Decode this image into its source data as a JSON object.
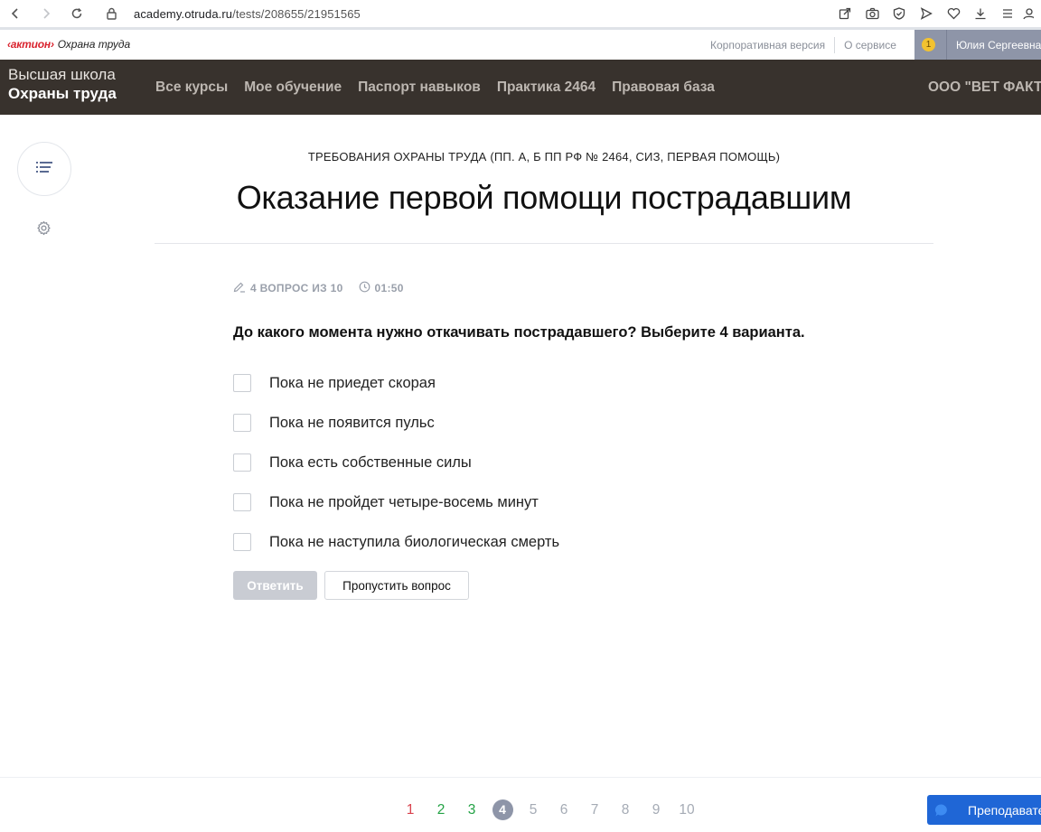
{
  "browser": {
    "url_host": "academy.otruda.ru",
    "url_path": "/tests/208655/21951565"
  },
  "site": {
    "brand": "актион",
    "brand_sub": "Охрана труда",
    "links": [
      "Корпоративная версия",
      "О сервисе"
    ],
    "user_badge": "1",
    "user_name": "Юлия Сергеевна"
  },
  "nav": {
    "school_line1": "Высшая школа",
    "school_line2": "Охраны труда",
    "items": [
      "Все курсы",
      "Мое обучение",
      "Паспорт навыков",
      "Практика 2464",
      "Правовая база"
    ],
    "org": "ООО \"ВЕТ ФАКТ"
  },
  "test": {
    "course": "ТРЕБОВАНИЯ ОХРАНЫ ТРУДА (ПП. А, Б ПП РФ № 2464, СИЗ, ПЕРВАЯ ПОМОЩЬ)",
    "title": "Оказание первой помощи пострадавшим",
    "progress": "4 ВОПРОС ИЗ 10",
    "timer": "01:50",
    "question": "До какого момента нужно откачивать пострадавшего? Выберите 4 варианта.",
    "options": [
      "Пока не приедет скорая",
      "Пока не появится пульс",
      "Пока есть собственные силы",
      "Пока не пройдет четыре-восемь минут",
      "Пока не наступила биологическая смерть"
    ],
    "answer_label": "Ответить",
    "skip_label": "Пропустить вопрос"
  },
  "pager": {
    "pages": [
      "1",
      "2",
      "3",
      "4",
      "5",
      "6",
      "7",
      "8",
      "9",
      "10"
    ],
    "current": "4",
    "colors": {
      "wrong": "#d9434e",
      "correct": "#23a245",
      "current_bg": "#8e95a8"
    }
  },
  "teacher": {
    "label": "Преподаватель"
  }
}
